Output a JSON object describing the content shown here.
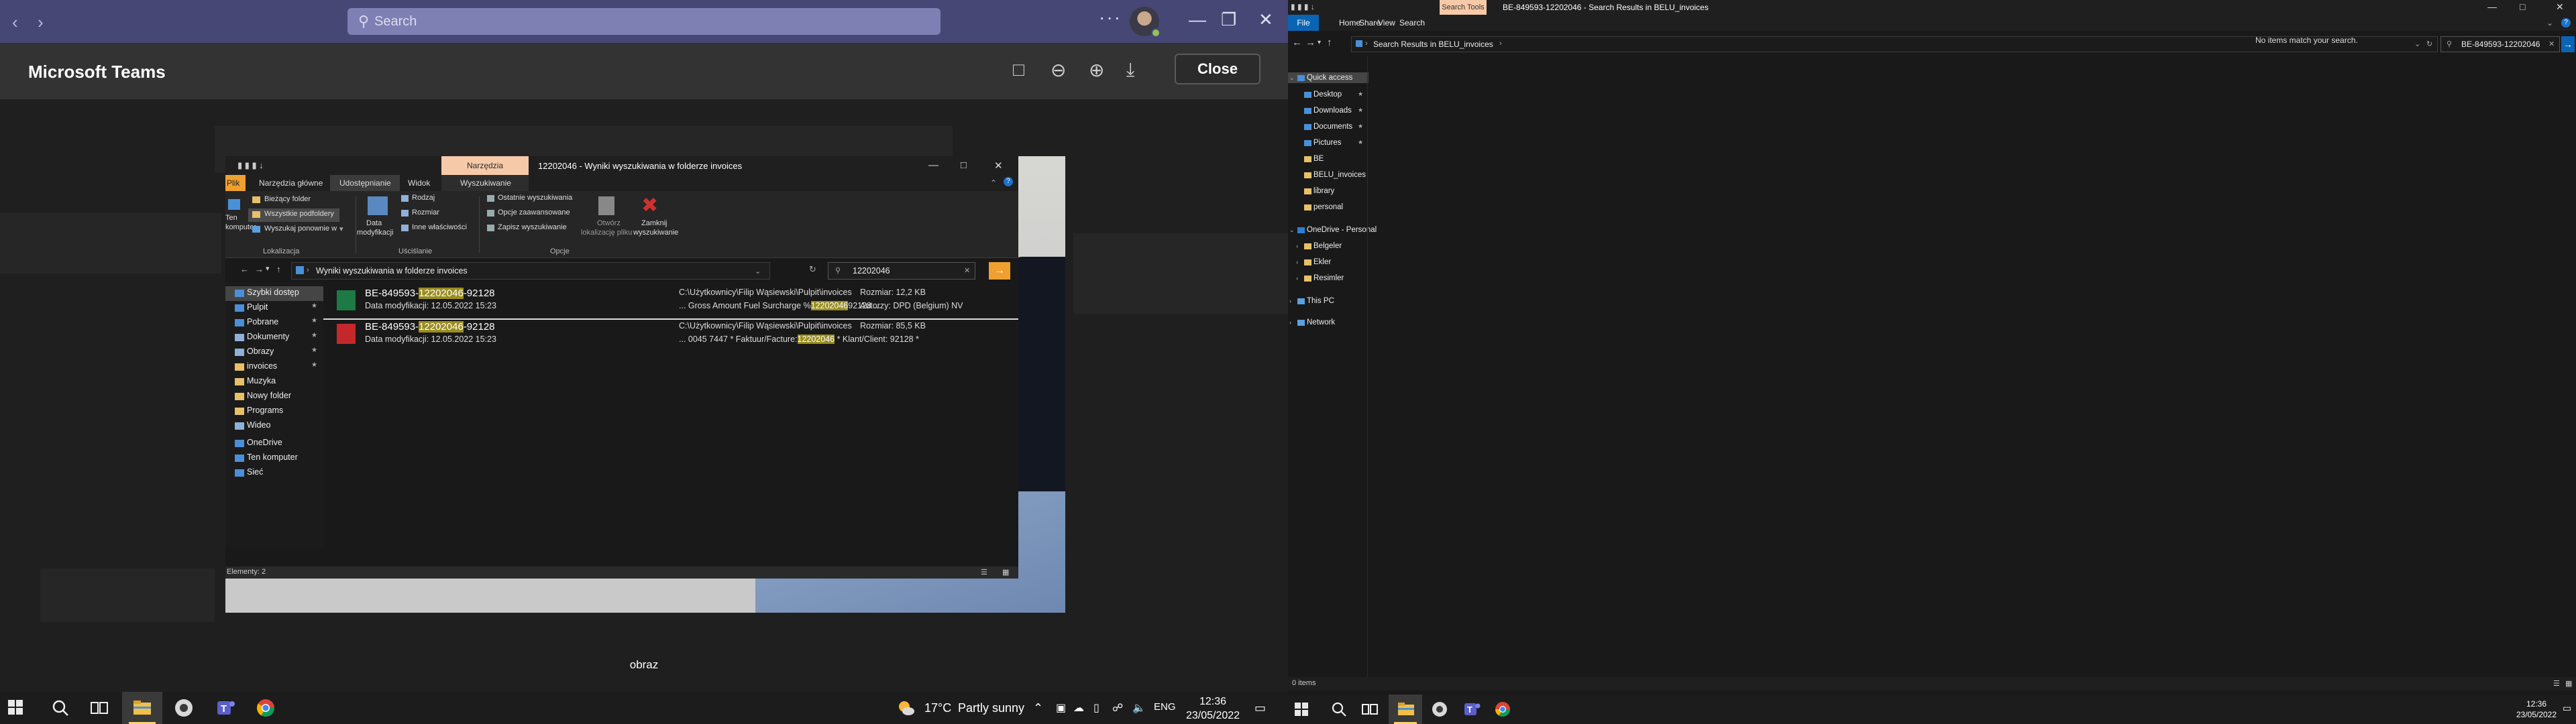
{
  "teams": {
    "search_placeholder": "Search",
    "viewer_title": "Microsoft Teams",
    "close_label": "Close",
    "caption": "obraz"
  },
  "mini_explorer": {
    "title": "12202046 - Wyniki wyszukiwania w folderze invoices",
    "tools_tab": "Narzędzia wyszukiwania",
    "ribbon_tabs": [
      "Plik",
      "Narzędzia główne",
      "Udostępnianie",
      "Widok",
      "Wyszukiwanie"
    ],
    "ribbon": {
      "left_clip": [
        "Ten",
        "komputer"
      ],
      "location_items": [
        "Bieżący folder",
        "Wszystkie podfoldery",
        "Wyszukaj ponownie w"
      ],
      "location_group": "Lokalizacja",
      "modified_label": [
        "Data",
        "modyfikacji"
      ],
      "refine_items": [
        "Rodzaj",
        "Rozmiar",
        "Inne właściwości"
      ],
      "refine_group": "Uściślanie",
      "options_items": [
        "Ostatnie wyszukiwania",
        "Opcje zaawansowane",
        "Zapisz wyszukiwanie"
      ],
      "options_group": "Opcje",
      "open_location": [
        "Otwórz",
        "lokalizację pliku"
      ],
      "close_search": [
        "Zamknij",
        "wyszukiwanie"
      ]
    },
    "address": "Wyniki wyszukiwania w folderze invoices",
    "search_value": "12202046",
    "nav": [
      {
        "label": "Szybki dostęp",
        "pinned": false
      },
      {
        "label": "Pulpit",
        "pinned": true
      },
      {
        "label": "Pobrane",
        "pinned": true
      },
      {
        "label": "Dokumenty",
        "pinned": true
      },
      {
        "label": "Obrazy",
        "pinned": true
      },
      {
        "label": "invoices",
        "pinned": true
      },
      {
        "label": "Muzyka",
        "pinned": false
      },
      {
        "label": "Nowy folder",
        "pinned": false
      },
      {
        "label": "Programs",
        "pinned": false
      },
      {
        "label": "Wideo",
        "pinned": false
      },
      {
        "label": "OneDrive",
        "pinned": false
      },
      {
        "label": "Ten komputer",
        "pinned": false
      },
      {
        "label": "Sieć",
        "pinned": false
      }
    ],
    "results": [
      {
        "name_pre": "BE-849593-",
        "name_hl": "12202046",
        "name_post": "-92128",
        "date": "Data modyfikacji: 12.05.2022 15:23",
        "path": "C:\\Użytkownicy\\Filip Wąsiewski\\Pulpit\\invoices",
        "snip_pre": "... Gross Amount Fuel Surcharge %",
        "snip_hl": "12202046",
        "snip_post": "92128 ...",
        "size": "Rozmiar: 12,2 KB",
        "extra": "Autorzy: DPD (Belgium) NV",
        "type": "excel"
      },
      {
        "name_pre": "BE-849593-",
        "name_hl": "12202046",
        "name_post": "-92128",
        "date": "Data modyfikacji: 12.05.2022 15:23",
        "path": "C:\\Użytkownicy\\Filip Wąsiewski\\Pulpit\\invoices",
        "snip_pre": "... 0045 7447 * Faktuur/Facture:",
        "snip_hl": "12202046",
        "snip_post": " * Klant/Client: 92128 *",
        "size": "Rozmiar: 85,5 KB",
        "extra": "",
        "type": "pdf"
      }
    ],
    "status": "Elementy: 2"
  },
  "taskbar_left": {
    "weather_temp": "17°C",
    "weather_text": "Partly sunny",
    "lang": "ENG",
    "time": "12:36",
    "date": "23/05/2022"
  },
  "right_explorer": {
    "tools_tab": "Search Tools",
    "title": "BE-849593-12202046 - Search Results in BELU_invoices",
    "tabs": [
      "File",
      "Home",
      "Share",
      "View",
      "Search"
    ],
    "address": "Search Results in BELU_invoices",
    "search_value": "BE-849593-12202046",
    "empty_message": "No items match your search.",
    "nav": [
      {
        "label": "Quick access",
        "kind": "section",
        "pinned": false
      },
      {
        "label": "Desktop",
        "kind": "item",
        "pinned": true
      },
      {
        "label": "Downloads",
        "kind": "item",
        "pinned": true
      },
      {
        "label": "Documents",
        "kind": "item",
        "pinned": true
      },
      {
        "label": "Pictures",
        "kind": "item",
        "pinned": true
      },
      {
        "label": "BE",
        "kind": "item",
        "pinned": false
      },
      {
        "label": "BELU_invoices",
        "kind": "item",
        "pinned": false
      },
      {
        "label": "library",
        "kind": "item",
        "pinned": false
      },
      {
        "label": "personal",
        "kind": "item",
        "pinned": false
      },
      {
        "label": "OneDrive - Personal",
        "kind": "section",
        "pinned": false
      },
      {
        "label": "Belgeler",
        "kind": "sub",
        "pinned": false
      },
      {
        "label": "Ekler",
        "kind": "sub",
        "pinned": false
      },
      {
        "label": "Resimler",
        "kind": "sub",
        "pinned": false
      },
      {
        "label": "This PC",
        "kind": "section",
        "pinned": false
      },
      {
        "label": "Network",
        "kind": "section",
        "pinned": false
      }
    ],
    "status": "0 items"
  },
  "taskbar_right": {
    "time": "12:36",
    "date": "23/05/2022"
  },
  "colors": {
    "teams_purple": "#464775",
    "search_highlight": "#9a8d20",
    "accent_orange": "#f0a030",
    "accent_blue": "#0a64b4"
  }
}
